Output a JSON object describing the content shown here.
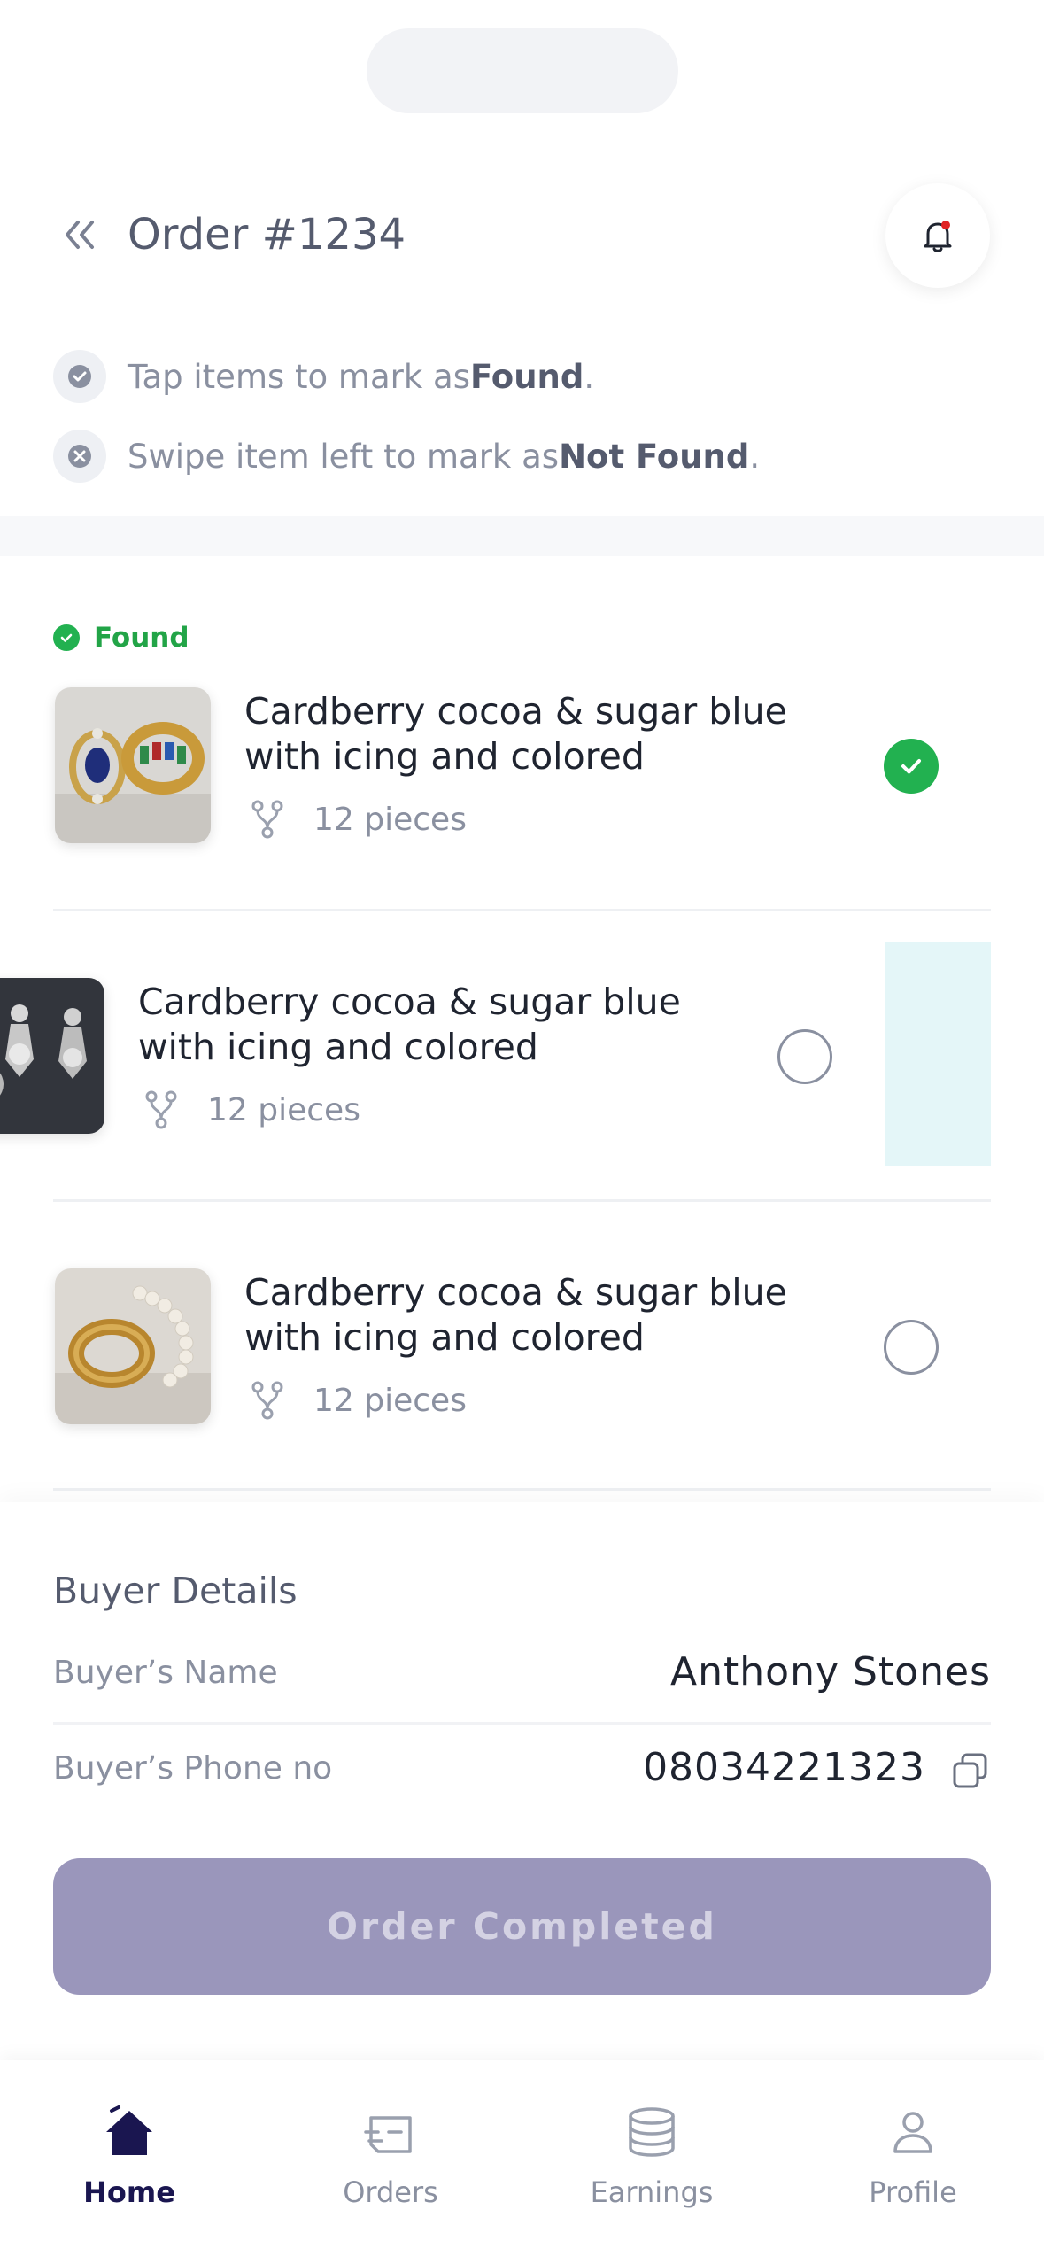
{
  "header": {
    "title": "Order #1234"
  },
  "hints": {
    "found": {
      "prefix": "Tap items to mark as ",
      "strong": "Found",
      "suffix": "."
    },
    "not_found": {
      "prefix": "Swipe item left to mark as ",
      "strong": "Not Found",
      "suffix": "."
    }
  },
  "found_section_label": "Found",
  "items": [
    {
      "name": "Cardberry cocoa & sugar blue with icing and colored",
      "pieces": "12 pieces",
      "status": "found"
    },
    {
      "name": "Cardberry cocoa & sugar blue with icing and colored",
      "pieces": "12 pieces",
      "status": "unchecked"
    },
    {
      "name": "Cardberry cocoa & sugar blue with icing and colored",
      "pieces": "12 pieces",
      "status": "unchecked"
    }
  ],
  "buyer": {
    "title": "Buyer Details",
    "name_label": "Buyer’s Name",
    "name_value": "Anthony Stones",
    "phone_label": "Buyer’s Phone no",
    "phone_value": "08034221323"
  },
  "cta_label": "Order Completed",
  "tabs": [
    {
      "label": "Home",
      "icon": "home-icon",
      "active": true
    },
    {
      "label": "Orders",
      "icon": "orders-icon",
      "active": false
    },
    {
      "label": "Earnings",
      "icon": "earnings-icon",
      "active": false
    },
    {
      "label": "Profile",
      "icon": "profile-icon",
      "active": false
    }
  ],
  "colors": {
    "accent": "#1a1650",
    "success": "#22b150",
    "cta_disabled": "#9a96bb",
    "muted": "#8a90a0"
  }
}
